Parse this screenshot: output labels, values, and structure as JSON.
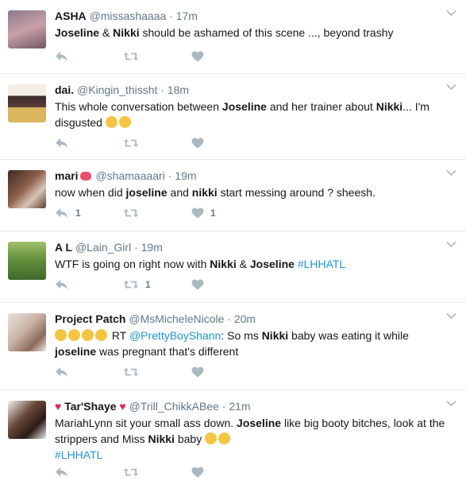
{
  "tweets": [
    {
      "name": "ASHA",
      "handle": "@missashaaaa",
      "time": "17m",
      "text_parts": [
        "Joseline",
        " & ",
        "Nikki",
        " should be ashamed of  this scene ..., beyond trashy"
      ],
      "reply_count": "",
      "retweet_count": "",
      "like_count": ""
    },
    {
      "name": "dai.",
      "handle": "@Kingin_thissht",
      "time": "18m",
      "text_parts": [
        "This whole conversation between ",
        "Joseline",
        " and her trainer about ",
        "Nikki",
        "... I'm disgusted "
      ],
      "emoji": [
        "confused-face-emoji",
        "expressionless-face-emoji"
      ],
      "reply_count": "",
      "retweet_count": "",
      "like_count": ""
    },
    {
      "name": "mari",
      "handle": "@shamaaaari",
      "time": "19m",
      "text_parts": [
        "now when did ",
        "joseline",
        " and ",
        "nikki",
        " start messing around ? sheesh."
      ],
      "reply_count": "1",
      "retweet_count": "",
      "like_count": "1"
    },
    {
      "name": "A L",
      "handle": "@Lain_Girl",
      "time": "19m",
      "text_parts": [
        "WTF is going on right now with ",
        "Nikki",
        " & ",
        "Joseline",
        " ",
        "#LHHATL"
      ],
      "reply_count": "",
      "retweet_count": "1",
      "like_count": ""
    },
    {
      "name": "Project Patch",
      "handle": "@MsMicheleNicole",
      "time": "20m",
      "text_parts": [
        "RT ",
        "@PrettyBoyShann",
        ": So ms ",
        "Nikki",
        " baby was eating it while ",
        "joseline",
        " was pregnant that's different"
      ],
      "reply_count": "",
      "retweet_count": "",
      "like_count": ""
    },
    {
      "name": "Tar'Shaye",
      "handle": "@Trill_ChikkABee",
      "time": "21m",
      "text_parts": [
        "MariahLynn sit your small ass down. ",
        "Joseline",
        " like big booty bitches, look at the strippers and Miss ",
        "Nikki",
        " baby "
      ],
      "hashtag": "#LHHATL",
      "reply_count": "",
      "retweet_count": "",
      "like_count": ""
    }
  ],
  "dot": "·",
  "colors": {
    "link": "#1b95e0",
    "muted": "#657786",
    "border": "#e1e8ed",
    "heart": "#e0245e"
  }
}
